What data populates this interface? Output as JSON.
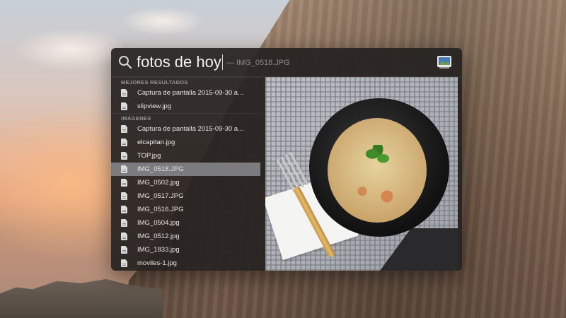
{
  "spotlight": {
    "query": "fotos de hoy",
    "completion": "— IMG_0518.JPG",
    "sections": [
      {
        "header": "MEJORES RESULTADOS",
        "items": [
          "Captura de pantalla 2015-09-30 a...",
          "slipview.jpg"
        ]
      },
      {
        "header": "IMÁGENES",
        "items": [
          "Captura de pantalla 2015-09-30 a...",
          "elcapitan.jpg",
          "TOP.jpg",
          "IMG_0518.JPG",
          "IMG_0502.jpg",
          "IMG_0517.JPG",
          "IMG_0516.JPG",
          "IMG_0504.jpg",
          "IMG_0512.jpg",
          "IMG_1833.jpg",
          "moviles-1.jpg"
        ]
      }
    ],
    "selected_item": "IMG_0518.JPG",
    "preview_icon": "preview-app-icon",
    "colors": {
      "panel": "#262221",
      "selected_row": "#7c7b7f"
    }
  }
}
